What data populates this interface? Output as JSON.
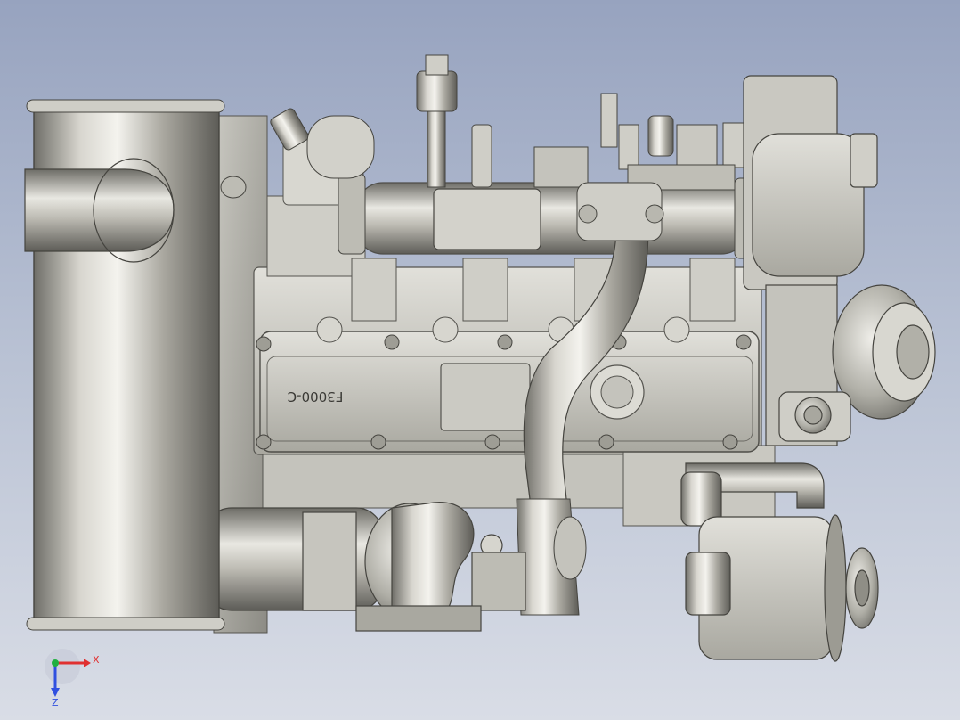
{
  "viewport": {
    "model_label": "F3000-C"
  },
  "triad": {
    "x_label": "X",
    "z_label": "Z",
    "x_color": "#e03030",
    "y_color": "#20b040",
    "z_color": "#3050e0"
  }
}
